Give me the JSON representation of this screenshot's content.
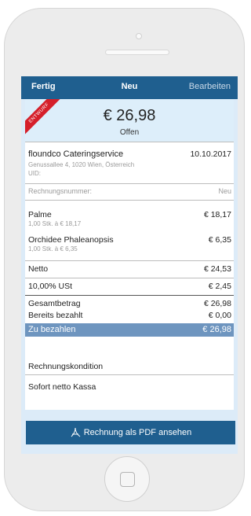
{
  "nav": {
    "left": "Fertig",
    "center": "Neu",
    "right": "Bearbeiten"
  },
  "invoice": {
    "draft_badge": "ENTWURF",
    "total": "€ 26,98",
    "status": "Offen",
    "customer_name": "floundco Cateringservice",
    "date": "10.10.2017",
    "address": "Genussallee 4, 1020 Wien, Österreich",
    "uid_label": "UID:",
    "number_label": "Rechnungsnummer:",
    "number_value": "Neu",
    "items": [
      {
        "name": "Palme",
        "detail": "1,00 Stk. à € 18,17",
        "amount": "€ 18,17"
      },
      {
        "name": "Orchidee Phaleanopsis",
        "detail": "1,00 Stk. à € 6,35",
        "amount": "€ 6,35"
      }
    ],
    "net_label": "Netto",
    "net_value": "€ 24,53",
    "tax_label": "10,00% USt",
    "tax_value": "€ 2,45",
    "gross_label": "Gesamtbetrag",
    "gross_value": "€ 26,98",
    "paid_label": "Bereits bezahlt",
    "paid_value": "€ 0,00",
    "due_label": "Zu bezahlen",
    "due_value": "€ 26,98"
  },
  "conditions": {
    "title": "Rechnungskondition",
    "value": "Sofort netto Kassa"
  },
  "pdf_button": {
    "label": "Rechnung als PDF ansehen",
    "icon": "pdf-icon"
  },
  "colors": {
    "navbar": "#1f5f8f",
    "due_highlight": "#6e95bf",
    "draft_ribbon": "#d51f2a",
    "screen_bg": "#dcebf8"
  }
}
